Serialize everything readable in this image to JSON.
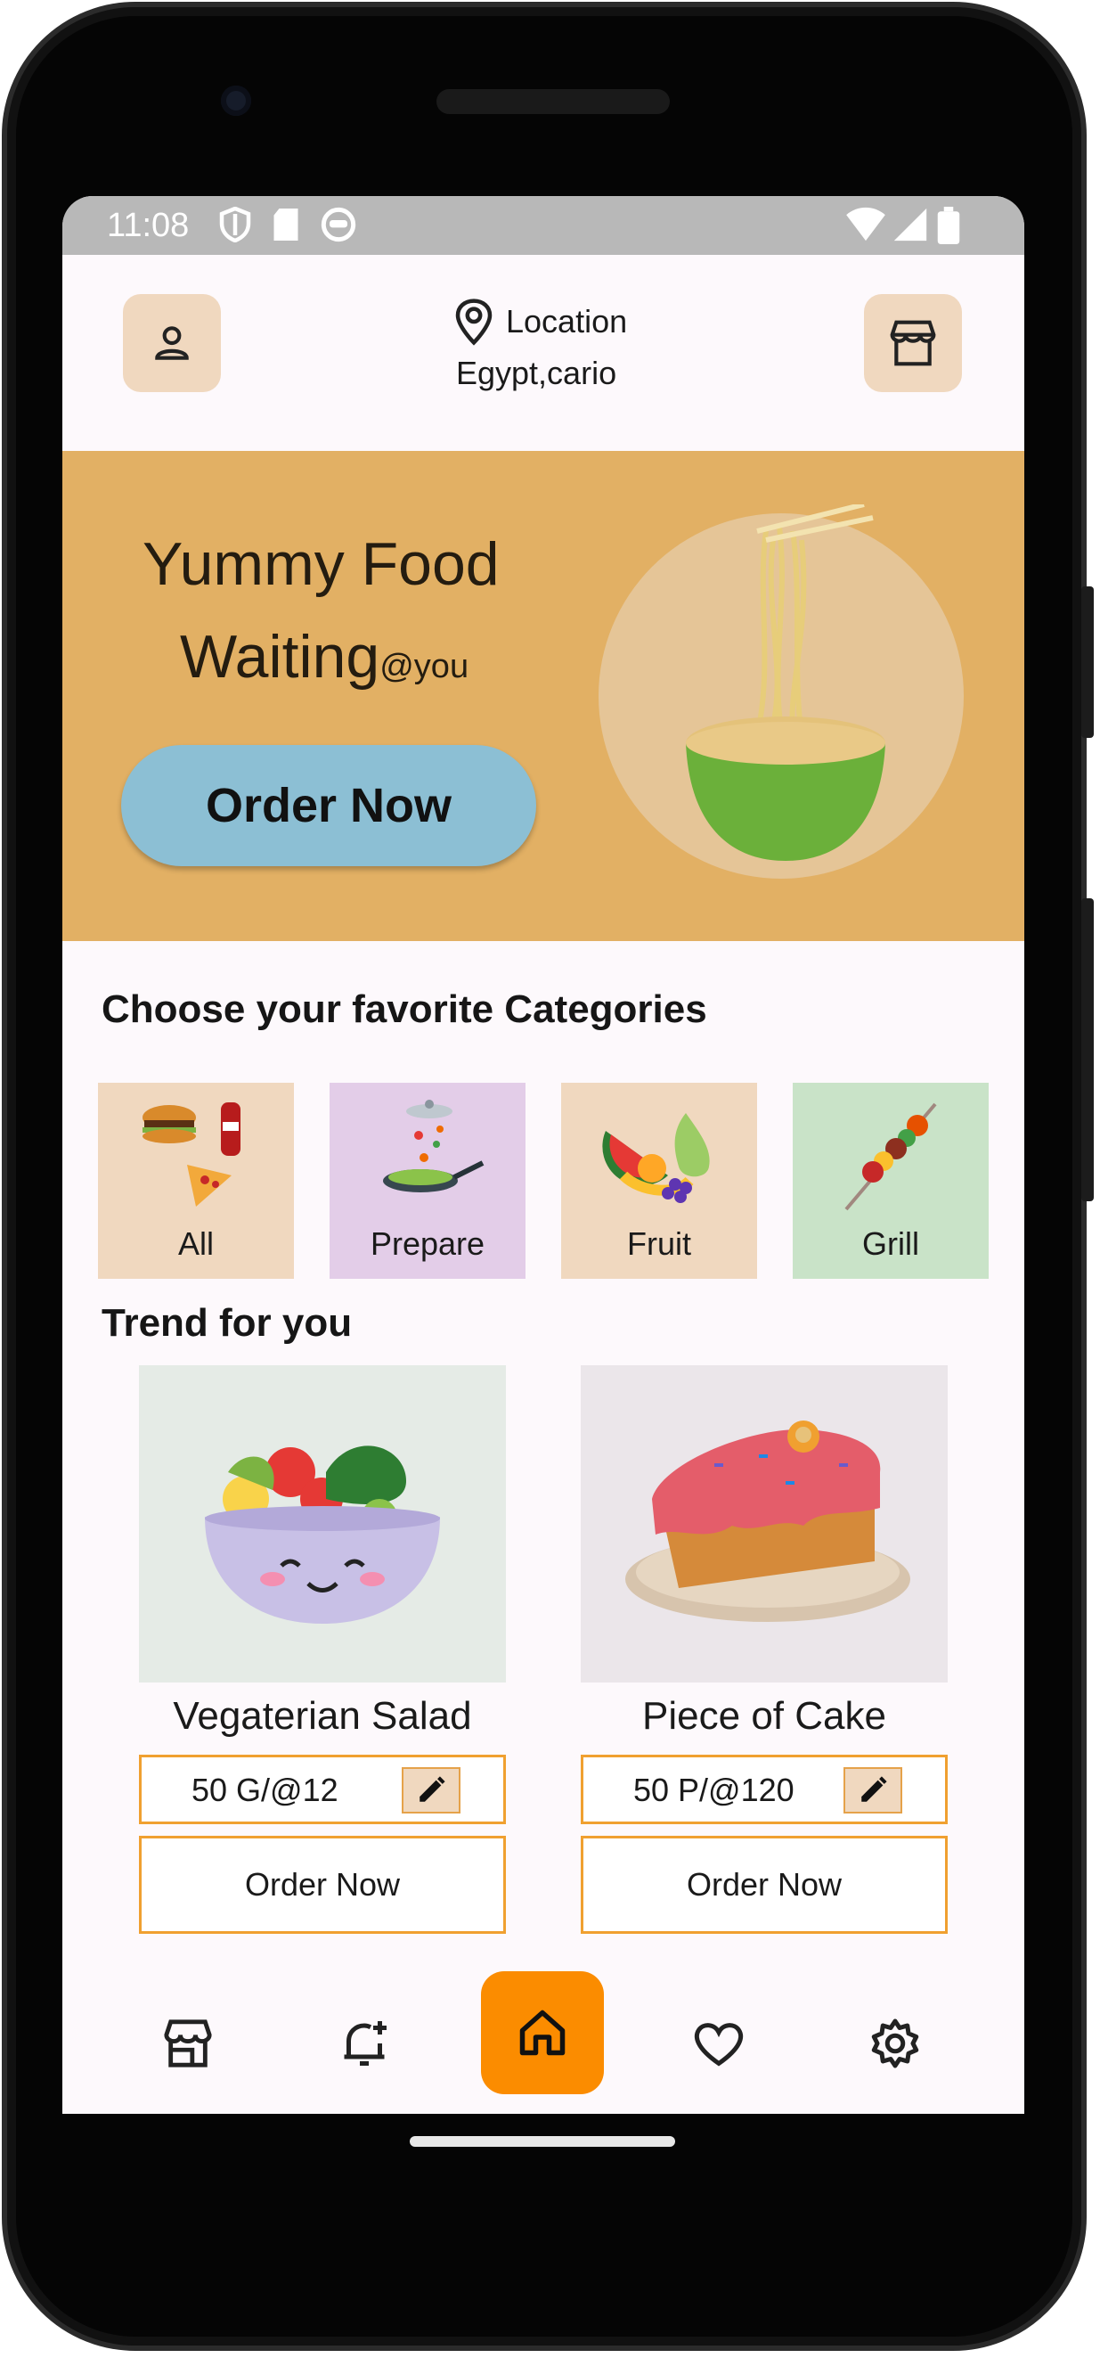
{
  "status_bar": {
    "time": "11:08"
  },
  "header": {
    "location_label": "Location",
    "location_value": "Egypt,cario"
  },
  "banner": {
    "line1": "Yummy Food",
    "line2": "Waiting",
    "line2_suffix": "@you",
    "order_button": "Order Now"
  },
  "categories": {
    "title": "Choose your favorite Categories",
    "items": [
      {
        "label": "All",
        "color": "#f0d8bf"
      },
      {
        "label": "Prepare",
        "color": "#e3cde8"
      },
      {
        "label": "Fruit",
        "color": "#f0d8bf"
      },
      {
        "label": "Grill",
        "color": "#c9e3c8"
      }
    ]
  },
  "trend": {
    "title": "Trend for you",
    "items": [
      {
        "name": "Vegaterian Salad",
        "price": "50 G/@12",
        "order_label": "Order Now"
      },
      {
        "name": "Piece of Cake",
        "price": "50 P/@120",
        "order_label": "Order Now"
      }
    ]
  },
  "bottom_nav": [
    "store-icon",
    "notification-add-icon",
    "home-icon",
    "heart-icon",
    "settings-icon"
  ],
  "colors": {
    "accent": "#fb8c00",
    "banner": "#e2b064",
    "order_button": "#8cbfd4",
    "border": "#f0a030"
  }
}
